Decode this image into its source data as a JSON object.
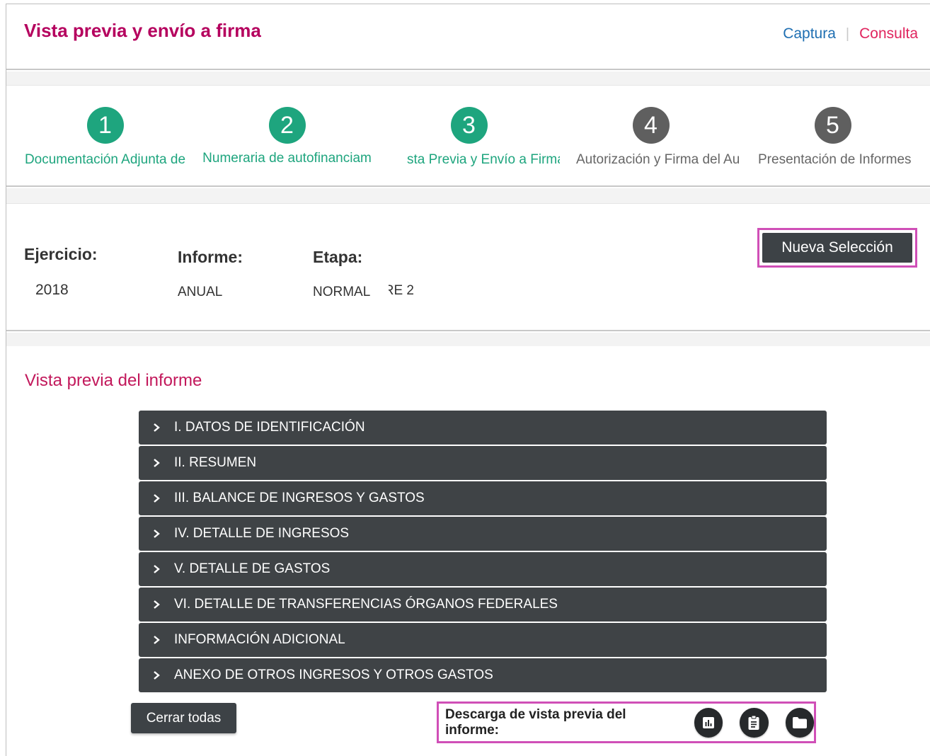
{
  "header": {
    "title": "Vista previa y envío a firma",
    "links": {
      "captura": "Captura",
      "separator": "|",
      "consulta": "Consulta"
    }
  },
  "stepper": {
    "steps": [
      {
        "number": "1",
        "label": "Documentación Adjunta de",
        "status": "done"
      },
      {
        "number": "2",
        "label": "Numeraria de autofinanciam",
        "status": "done"
      },
      {
        "number": "3",
        "label": "sta Previa y Envío a Firma",
        "status": "done"
      },
      {
        "number": "4",
        "label": "Autorización y Firma del Au",
        "status": "pending"
      },
      {
        "number": "5",
        "label": "Presentación de Informes",
        "status": "pending"
      }
    ]
  },
  "selection": {
    "ejercicio_label": "Ejercicio:",
    "ejercicio_value": "2018",
    "informe_label": "Informe:",
    "informe_value": "ANUAL",
    "etapa_label": "Etapa:",
    "etapa_value": "NORMAL",
    "extra_value": "RE 2",
    "nueva_button": "Nueva Selección"
  },
  "preview": {
    "title": "Vista previa del informe",
    "sections": [
      "I. DATOS DE IDENTIFICACIÓN",
      "II. RESUMEN",
      "III. BALANCE DE INGRESOS Y GASTOS",
      "IV. DETALLE DE INGRESOS",
      "V. DETALLE DE GASTOS",
      "VI. DETALLE DE TRANSFERENCIAS ÓRGANOS FEDERALES",
      "INFORMACIÓN ADICIONAL",
      "ANEXO DE OTROS INGRESOS Y OTROS GASTOS"
    ],
    "close_all": "Cerrar todas",
    "download_label": "Descarga de vista previa del informe:",
    "download_icons": [
      "chart-icon",
      "clipboard-icon",
      "folder-icon"
    ]
  },
  "colors": {
    "title_magenta": "#b5005e",
    "done_green": "#1ea57e",
    "pending_gray": "#5f5f5f",
    "dark_button": "#3d4246",
    "highlight": "#d04fb7"
  }
}
